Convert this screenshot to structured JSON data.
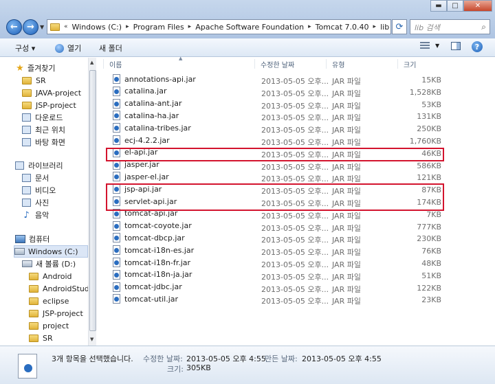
{
  "window": {
    "buttons": {
      "minimize": "▬",
      "maximize": "□",
      "close": "✕"
    }
  },
  "address": {
    "prefix": "«",
    "crumbs": [
      "Windows (C:)",
      "Program Files",
      "Apache Software Foundation",
      "Tomcat 7.0.40",
      "lib"
    ],
    "separator": "▸"
  },
  "search": {
    "placeholder": "lib 검색"
  },
  "toolbar": {
    "organize": "구성 ▾",
    "burn": "열기",
    "new_folder": "새 폴더"
  },
  "navpane": {
    "favorites": "즐겨찾기",
    "fav_items": [
      "SR",
      "JAVA-project",
      "JSP-project",
      "다운로드",
      "최근 위치",
      "바탕 화면"
    ],
    "libraries": "라이브러리",
    "lib_items": [
      "문서",
      "비디오",
      "사진",
      "음악"
    ],
    "computer": "컴퓨터",
    "drives": [
      "Windows (C:)",
      "새 볼륨 (D:)"
    ],
    "d_items": [
      "Android",
      "AndroidStudio",
      "eclipse",
      "JSP-project",
      "project",
      "SR"
    ]
  },
  "columns": {
    "name": "이름",
    "date": "수정한 날짜",
    "type": "유형",
    "size": "크기"
  },
  "files": [
    {
      "name": "annotations-api.jar",
      "date": "2013-05-05 오후...",
      "type": "JAR 파일",
      "size": "15KB"
    },
    {
      "name": "catalina.jar",
      "date": "2013-05-05 오후...",
      "type": "JAR 파일",
      "size": "1,528KB"
    },
    {
      "name": "catalina-ant.jar",
      "date": "2013-05-05 오후...",
      "type": "JAR 파일",
      "size": "53KB"
    },
    {
      "name": "catalina-ha.jar",
      "date": "2013-05-05 오후...",
      "type": "JAR 파일",
      "size": "131KB"
    },
    {
      "name": "catalina-tribes.jar",
      "date": "2013-05-05 오후...",
      "type": "JAR 파일",
      "size": "250KB"
    },
    {
      "name": "ecj-4.2.2.jar",
      "date": "2013-05-05 오후...",
      "type": "JAR 파일",
      "size": "1,760KB"
    },
    {
      "name": "el-api.jar",
      "date": "2013-05-05 오후...",
      "type": "JAR 파일",
      "size": "46KB"
    },
    {
      "name": "jasper.jar",
      "date": "2013-05-05 오후...",
      "type": "JAR 파일",
      "size": "586KB"
    },
    {
      "name": "jasper-el.jar",
      "date": "2013-05-05 오후...",
      "type": "JAR 파일",
      "size": "121KB"
    },
    {
      "name": "jsp-api.jar",
      "date": "2013-05-05 오후...",
      "type": "JAR 파일",
      "size": "87KB"
    },
    {
      "name": "servlet-api.jar",
      "date": "2013-05-05 오후...",
      "type": "JAR 파일",
      "size": "174KB"
    },
    {
      "name": "tomcat-api.jar",
      "date": "2013-05-05 오후...",
      "type": "JAR 파일",
      "size": "7KB"
    },
    {
      "name": "tomcat-coyote.jar",
      "date": "2013-05-05 오후...",
      "type": "JAR 파일",
      "size": "777KB"
    },
    {
      "name": "tomcat-dbcp.jar",
      "date": "2013-05-05 오후...",
      "type": "JAR 파일",
      "size": "230KB"
    },
    {
      "name": "tomcat-i18n-es.jar",
      "date": "2013-05-05 오후...",
      "type": "JAR 파일",
      "size": "76KB"
    },
    {
      "name": "tomcat-i18n-fr.jar",
      "date": "2013-05-05 오후...",
      "type": "JAR 파일",
      "size": "48KB"
    },
    {
      "name": "tomcat-i18n-ja.jar",
      "date": "2013-05-05 오후...",
      "type": "JAR 파일",
      "size": "51KB"
    },
    {
      "name": "tomcat-jdbc.jar",
      "date": "2013-05-05 오후...",
      "type": "JAR 파일",
      "size": "122KB"
    },
    {
      "name": "tomcat-util.jar",
      "date": "2013-05-05 오후...",
      "type": "JAR 파일",
      "size": "23KB"
    }
  ],
  "details": {
    "selection": "3개 항목을 선택했습니다.",
    "modified_label": "수정한 날짜:",
    "modified_value": "2013-05-05 오후 4:55",
    "created_label": "만든 날짜:",
    "created_value": "2013-05-05 오후 4:55",
    "size_label": "크기:",
    "size_value": "305KB"
  },
  "colors": {
    "highlight_box": "#d3132d",
    "accent": "#2a6dc0"
  }
}
